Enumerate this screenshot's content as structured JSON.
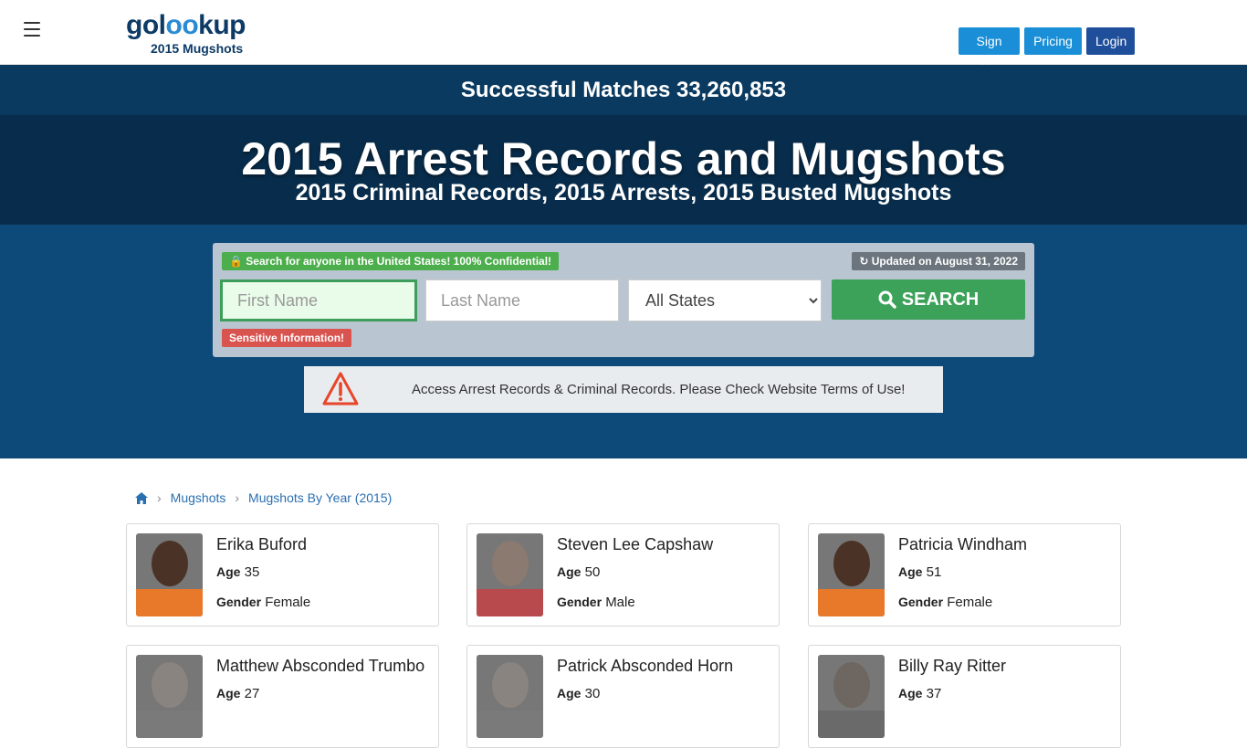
{
  "header": {
    "logo_text_a": "gol",
    "logo_text_oo": "oo",
    "logo_text_b": "kup",
    "logo_sub": "2015 Mugshots",
    "signup": "Sign Up",
    "pricing": "Pricing",
    "login": "Login"
  },
  "hero": {
    "matches": "Successful Matches 33,260,853",
    "title": "2015 Arrest Records and Mugshots",
    "subtitle": "2015 Criminal Records, 2015 Arrests, 2015 Busted Mugshots"
  },
  "search": {
    "confidential_badge": "Search for anyone in the United States! 100% Confidential!",
    "updated_badge": "Updated on August 31, 2022",
    "first_name_placeholder": "First Name",
    "last_name_placeholder": "Last Name",
    "state_selected": "All States",
    "search_button": "SEARCH",
    "sensitive_badge": "Sensitive Information!"
  },
  "notice": {
    "text": "Access Arrest Records & Criminal Records. Please Check Website Terms of Use!"
  },
  "breadcrumb": {
    "items": [
      "Mugshots",
      "Mugshots By Year (2015)"
    ]
  },
  "labels": {
    "age": "Age",
    "gender": "Gender"
  },
  "colors": {
    "navy": "#0e4a79",
    "navy_dark": "#082d4c",
    "green": "#3ca25a",
    "blue_button": "#1a8fd8",
    "red_badge": "#d9534f"
  },
  "people": [
    {
      "name": "Erika Buford",
      "age": "35",
      "gender": "Female",
      "shirt": "#e8782a",
      "skin": "#4a3326"
    },
    {
      "name": "Steven Lee Capshaw",
      "age": "50",
      "gender": "Male",
      "shirt": "#b84a4e",
      "skin": "#8a7a70"
    },
    {
      "name": "Patricia Windham",
      "age": "51",
      "gender": "Female",
      "shirt": "#e8782a",
      "skin": "#4a3326"
    },
    {
      "name": "Matthew Absconded Trumbo",
      "age": "27",
      "gender": "",
      "shirt": "#7a7a7a",
      "skin": "#8a8480"
    },
    {
      "name": "Patrick Absconded Horn",
      "age": "30",
      "gender": "",
      "shirt": "#7a7a7a",
      "skin": "#8a8480"
    },
    {
      "name": "Billy Ray Ritter",
      "age": "37",
      "gender": "",
      "shirt": "#6a6a6a",
      "skin": "#6e6660"
    }
  ]
}
